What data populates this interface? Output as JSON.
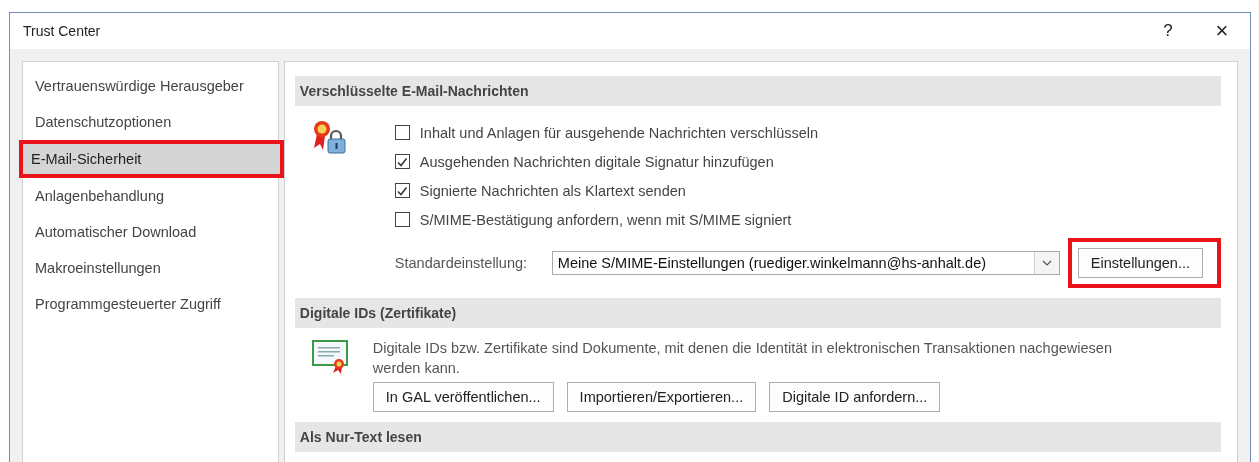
{
  "window": {
    "title": "Trust Center",
    "help": "?",
    "close": "×"
  },
  "sidebar": {
    "items": [
      {
        "label": "Vertrauenswürdige Herausgeber",
        "selected": false,
        "highlighted": false
      },
      {
        "label": "Datenschutzoptionen",
        "selected": false,
        "highlighted": false
      },
      {
        "label": "E-Mail-Sicherheit",
        "selected": true,
        "highlighted": true
      },
      {
        "label": "Anlagenbehandlung",
        "selected": false,
        "highlighted": false
      },
      {
        "label": "Automatischer Download",
        "selected": false,
        "highlighted": false
      },
      {
        "label": "Makroeinstellungen",
        "selected": false,
        "highlighted": false
      },
      {
        "label": "Programmgesteuerter Zugriff",
        "selected": false,
        "highlighted": false
      }
    ]
  },
  "encrypted_mail": {
    "heading": "Verschlüsselte E-Mail-Nachrichten",
    "options": [
      {
        "label": "Inhalt und Anlagen für ausgehende Nachrichten verschlüsseln",
        "checked": false
      },
      {
        "label": "Ausgehenden Nachrichten digitale Signatur hinzufügen",
        "checked": true
      },
      {
        "label": "Signierte Nachrichten als Klartext senden",
        "checked": true
      },
      {
        "label": "S/MIME-Bestätigung anfordern, wenn mit S/MIME signiert",
        "checked": false
      }
    ],
    "default_setting": {
      "label": "Standardeinstellung:",
      "value": "Meine S/MIME-Einstellungen (ruediger.winkelmann@hs-anhalt.de)"
    },
    "settings_button": {
      "label": "Einstellungen...",
      "highlighted": true
    }
  },
  "digital_ids": {
    "heading": "Digitale IDs (Zertifikate)",
    "description": "Digitale IDs bzw. Zertifikate sind Dokumente, mit denen die Identität in elektronischen Transaktionen nachgewiesen werden kann.",
    "buttons": [
      {
        "label": "In GAL veröffentlichen..."
      },
      {
        "label": "Importieren/Exportieren..."
      },
      {
        "label": "Digitale ID anfordern..."
      }
    ]
  },
  "plain_text": {
    "heading": "Als Nur-Text lesen"
  }
}
